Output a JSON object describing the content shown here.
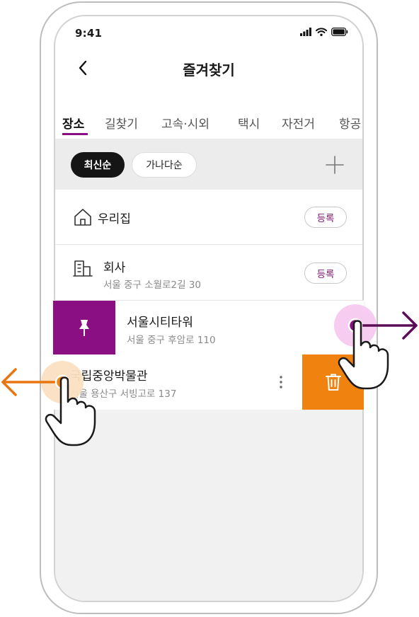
{
  "status_bar": {
    "time": "9:41"
  },
  "header": {
    "title": "즐겨찾기",
    "back_icon": "chevron-left-icon"
  },
  "tabs": [
    {
      "label": "장소",
      "active": true
    },
    {
      "label": "길찾기",
      "active": false
    },
    {
      "label": "고속·시외",
      "active": false
    },
    {
      "label": "택시",
      "active": false
    },
    {
      "label": "자전거",
      "active": false
    },
    {
      "label": "항공",
      "active": false
    }
  ],
  "filters": {
    "latest": "최신순",
    "alphabetical": "가나다순",
    "add_icon": "plus-icon"
  },
  "favorites": {
    "home": {
      "name": "우리집",
      "button": "등록",
      "icon": "house-icon"
    },
    "office": {
      "name": "회사",
      "address": "서울 중구 소월로2길 30",
      "button": "등록",
      "icon": "building-icon"
    },
    "items": [
      {
        "name": "서울시티타워",
        "address": "서울 중구 후암로 110",
        "swipe_action": "pin-icon"
      },
      {
        "name": "국립중앙박물관",
        "address": "서울 용산구 서빙고로 137",
        "swipe_action": "trash-icon"
      }
    ]
  },
  "colors": {
    "accent": "#8a0f82",
    "delete": "#f0820f",
    "gesture_purple": "#5a0d57",
    "gesture_orange": "#e8750f"
  }
}
